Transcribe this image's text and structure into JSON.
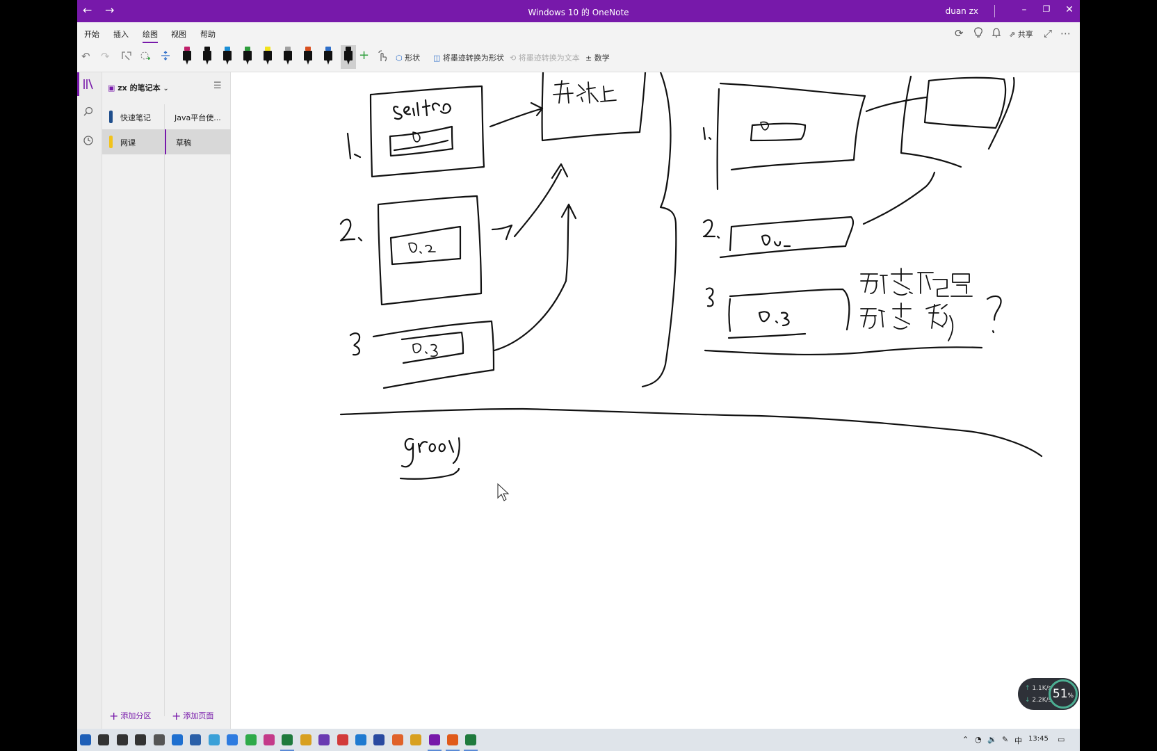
{
  "window": {
    "title": "Windows 10 的 OneNote",
    "user": "duan zx",
    "back_icon": "←",
    "forward_icon": "→",
    "minimize_icon": "–",
    "restore_icon": "❐",
    "close_icon": "✕"
  },
  "ribbon": {
    "tabs": [
      "开始",
      "插入",
      "绘图",
      "视图",
      "帮助"
    ],
    "active_tab": "绘图",
    "share_label": "共享"
  },
  "toolbar": {
    "shapes_label": "形状",
    "ink_to_shape_label": "将墨迹转换为形状",
    "ink_to_text_label": "将墨迹转换为文本",
    "math_label": "数学",
    "pen_colors": [
      "#c0206a",
      "#111111",
      "#1b8fd6",
      "#2e9e3c",
      "#f2e21b",
      "#a0a0a0",
      "#d9501f",
      "#2f6fc9",
      "#111111"
    ]
  },
  "notebook": {
    "name": "zx 的笔记本",
    "sections": [
      {
        "label": "快速笔记",
        "color": "#1f4e8c",
        "selected": false
      },
      {
        "label": "网课",
        "color": "#f2c31b",
        "selected": true
      }
    ],
    "pages": [
      {
        "label": "Java平台使...",
        "selected": false
      },
      {
        "label": "草稿",
        "selected": true
      }
    ],
    "add_section_label": "添加分区",
    "add_page_label": "添加页面"
  },
  "ink_text": {
    "service": "service",
    "upper": "升级上",
    "d1": "D",
    "d2": "D.2",
    "d3": "D.3",
    "n1": "1.",
    "n2": "2.",
    "n3": "3",
    "dynamic_config": "动态配置",
    "dynamic_upgrade": "动态升级",
    "question": "?",
    "groovy": "groovy"
  },
  "speed_widget": {
    "up": "1.1K/s",
    "down": "2.2K/s",
    "percent": "51",
    "percent_unit": "%"
  },
  "taskbar": {
    "ime": "中",
    "clock": "13:45"
  }
}
